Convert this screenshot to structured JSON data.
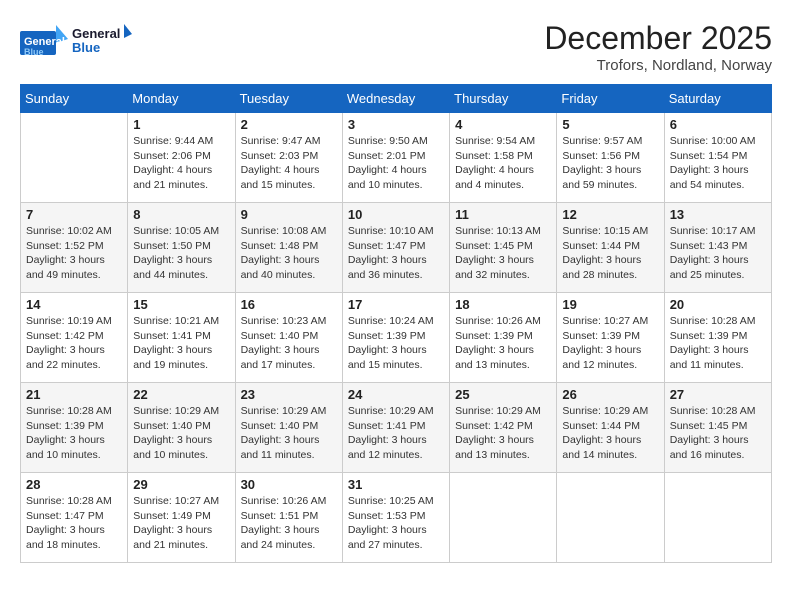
{
  "header": {
    "logo_line1": "General",
    "logo_line2": "Blue",
    "month": "December 2025",
    "location": "Trofors, Nordland, Norway"
  },
  "weekdays": [
    "Sunday",
    "Monday",
    "Tuesday",
    "Wednesday",
    "Thursday",
    "Friday",
    "Saturday"
  ],
  "weeks": [
    [
      {
        "day": "",
        "sunrise": "",
        "sunset": "",
        "daylight": ""
      },
      {
        "day": "1",
        "sunrise": "Sunrise: 9:44 AM",
        "sunset": "Sunset: 2:06 PM",
        "daylight": "Daylight: 4 hours and 21 minutes."
      },
      {
        "day": "2",
        "sunrise": "Sunrise: 9:47 AM",
        "sunset": "Sunset: 2:03 PM",
        "daylight": "Daylight: 4 hours and 15 minutes."
      },
      {
        "day": "3",
        "sunrise": "Sunrise: 9:50 AM",
        "sunset": "Sunset: 2:01 PM",
        "daylight": "Daylight: 4 hours and 10 minutes."
      },
      {
        "day": "4",
        "sunrise": "Sunrise: 9:54 AM",
        "sunset": "Sunset: 1:58 PM",
        "daylight": "Daylight: 4 hours and 4 minutes."
      },
      {
        "day": "5",
        "sunrise": "Sunrise: 9:57 AM",
        "sunset": "Sunset: 1:56 PM",
        "daylight": "Daylight: 3 hours and 59 minutes."
      },
      {
        "day": "6",
        "sunrise": "Sunrise: 10:00 AM",
        "sunset": "Sunset: 1:54 PM",
        "daylight": "Daylight: 3 hours and 54 minutes."
      }
    ],
    [
      {
        "day": "7",
        "sunrise": "Sunrise: 10:02 AM",
        "sunset": "Sunset: 1:52 PM",
        "daylight": "Daylight: 3 hours and 49 minutes."
      },
      {
        "day": "8",
        "sunrise": "Sunrise: 10:05 AM",
        "sunset": "Sunset: 1:50 PM",
        "daylight": "Daylight: 3 hours and 44 minutes."
      },
      {
        "day": "9",
        "sunrise": "Sunrise: 10:08 AM",
        "sunset": "Sunset: 1:48 PM",
        "daylight": "Daylight: 3 hours and 40 minutes."
      },
      {
        "day": "10",
        "sunrise": "Sunrise: 10:10 AM",
        "sunset": "Sunset: 1:47 PM",
        "daylight": "Daylight: 3 hours and 36 minutes."
      },
      {
        "day": "11",
        "sunrise": "Sunrise: 10:13 AM",
        "sunset": "Sunset: 1:45 PM",
        "daylight": "Daylight: 3 hours and 32 minutes."
      },
      {
        "day": "12",
        "sunrise": "Sunrise: 10:15 AM",
        "sunset": "Sunset: 1:44 PM",
        "daylight": "Daylight: 3 hours and 28 minutes."
      },
      {
        "day": "13",
        "sunrise": "Sunrise: 10:17 AM",
        "sunset": "Sunset: 1:43 PM",
        "daylight": "Daylight: 3 hours and 25 minutes."
      }
    ],
    [
      {
        "day": "14",
        "sunrise": "Sunrise: 10:19 AM",
        "sunset": "Sunset: 1:42 PM",
        "daylight": "Daylight: 3 hours and 22 minutes."
      },
      {
        "day": "15",
        "sunrise": "Sunrise: 10:21 AM",
        "sunset": "Sunset: 1:41 PM",
        "daylight": "Daylight: 3 hours and 19 minutes."
      },
      {
        "day": "16",
        "sunrise": "Sunrise: 10:23 AM",
        "sunset": "Sunset: 1:40 PM",
        "daylight": "Daylight: 3 hours and 17 minutes."
      },
      {
        "day": "17",
        "sunrise": "Sunrise: 10:24 AM",
        "sunset": "Sunset: 1:39 PM",
        "daylight": "Daylight: 3 hours and 15 minutes."
      },
      {
        "day": "18",
        "sunrise": "Sunrise: 10:26 AM",
        "sunset": "Sunset: 1:39 PM",
        "daylight": "Daylight: 3 hours and 13 minutes."
      },
      {
        "day": "19",
        "sunrise": "Sunrise: 10:27 AM",
        "sunset": "Sunset: 1:39 PM",
        "daylight": "Daylight: 3 hours and 12 minutes."
      },
      {
        "day": "20",
        "sunrise": "Sunrise: 10:28 AM",
        "sunset": "Sunset: 1:39 PM",
        "daylight": "Daylight: 3 hours and 11 minutes."
      }
    ],
    [
      {
        "day": "21",
        "sunrise": "Sunrise: 10:28 AM",
        "sunset": "Sunset: 1:39 PM",
        "daylight": "Daylight: 3 hours and 10 minutes."
      },
      {
        "day": "22",
        "sunrise": "Sunrise: 10:29 AM",
        "sunset": "Sunset: 1:40 PM",
        "daylight": "Daylight: 3 hours and 10 minutes."
      },
      {
        "day": "23",
        "sunrise": "Sunrise: 10:29 AM",
        "sunset": "Sunset: 1:40 PM",
        "daylight": "Daylight: 3 hours and 11 minutes."
      },
      {
        "day": "24",
        "sunrise": "Sunrise: 10:29 AM",
        "sunset": "Sunset: 1:41 PM",
        "daylight": "Daylight: 3 hours and 12 minutes."
      },
      {
        "day": "25",
        "sunrise": "Sunrise: 10:29 AM",
        "sunset": "Sunset: 1:42 PM",
        "daylight": "Daylight: 3 hours and 13 minutes."
      },
      {
        "day": "26",
        "sunrise": "Sunrise: 10:29 AM",
        "sunset": "Sunset: 1:44 PM",
        "daylight": "Daylight: 3 hours and 14 minutes."
      },
      {
        "day": "27",
        "sunrise": "Sunrise: 10:28 AM",
        "sunset": "Sunset: 1:45 PM",
        "daylight": "Daylight: 3 hours and 16 minutes."
      }
    ],
    [
      {
        "day": "28",
        "sunrise": "Sunrise: 10:28 AM",
        "sunset": "Sunset: 1:47 PM",
        "daylight": "Daylight: 3 hours and 18 minutes."
      },
      {
        "day": "29",
        "sunrise": "Sunrise: 10:27 AM",
        "sunset": "Sunset: 1:49 PM",
        "daylight": "Daylight: 3 hours and 21 minutes."
      },
      {
        "day": "30",
        "sunrise": "Sunrise: 10:26 AM",
        "sunset": "Sunset: 1:51 PM",
        "daylight": "Daylight: 3 hours and 24 minutes."
      },
      {
        "day": "31",
        "sunrise": "Sunrise: 10:25 AM",
        "sunset": "Sunset: 1:53 PM",
        "daylight": "Daylight: 3 hours and 27 minutes."
      },
      {
        "day": "",
        "sunrise": "",
        "sunset": "",
        "daylight": ""
      },
      {
        "day": "",
        "sunrise": "",
        "sunset": "",
        "daylight": ""
      },
      {
        "day": "",
        "sunrise": "",
        "sunset": "",
        "daylight": ""
      }
    ]
  ]
}
